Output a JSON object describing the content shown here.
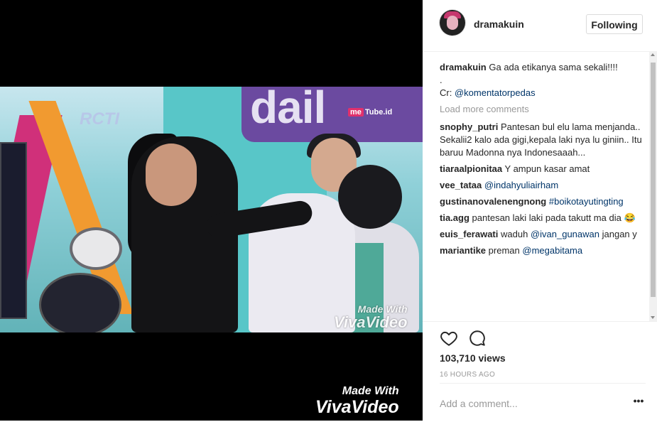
{
  "video": {
    "watermark_line1": "Made With",
    "watermark_line2": "VivaVideo",
    "inner_watermark_line1": "Made With",
    "inner_watermark_line2": "VivaVideo",
    "channel_logo": "me",
    "channel_logo_suffix": "Tube.id",
    "station_logo": "RCTI",
    "stage_text": "dail"
  },
  "post": {
    "username": "dramakuin",
    "follow_label": "Following",
    "caption_user": "dramakuin",
    "caption_text": "Ga ada etikanya sama sekali!!!!",
    "caption_dot": ".",
    "credit_prefix": "Cr: ",
    "credit_mention": "@komentatorpedas",
    "load_more": "Load more comments"
  },
  "comments": [
    {
      "user": "snophy_putri",
      "text": "Pantesan bul elu lama menjanda.. Sekalii2 kalo ada gigi,kepala laki nya lu giniin.. Itu baruu Madonna nya Indonesaaah...",
      "mention": ""
    },
    {
      "user": "tiaraalpionitaa",
      "text": "Y ampun kasar amat",
      "mention": ""
    },
    {
      "user": "vee_tataa",
      "text": "",
      "mention": "@indahyuliairham"
    },
    {
      "user": "gustinanovalenengnong",
      "text": "",
      "mention": "#boikotayutingting"
    },
    {
      "user": "tia.agg",
      "text": "pantesan laki laki pada takutt ma dia 😂",
      "mention": ""
    },
    {
      "user": "euis_ferawati",
      "text": "waduh",
      "mention": "@ivan_gunawan",
      "after": "jangan y"
    },
    {
      "user": "mariantike",
      "text": "preman",
      "mention": "@megabitama"
    }
  ],
  "stats": {
    "views": "103,710 views",
    "time": "16 HOURS AGO"
  },
  "comment_box": {
    "placeholder": "Add a comment...",
    "more_label": "•••"
  },
  "icons": {
    "like": "heart-icon",
    "comment": "comment-bubble-icon",
    "options": "more-options-icon"
  },
  "colors": {
    "mention": "#003569",
    "text": "#262626",
    "muted": "#999999",
    "border": "#efefef"
  }
}
